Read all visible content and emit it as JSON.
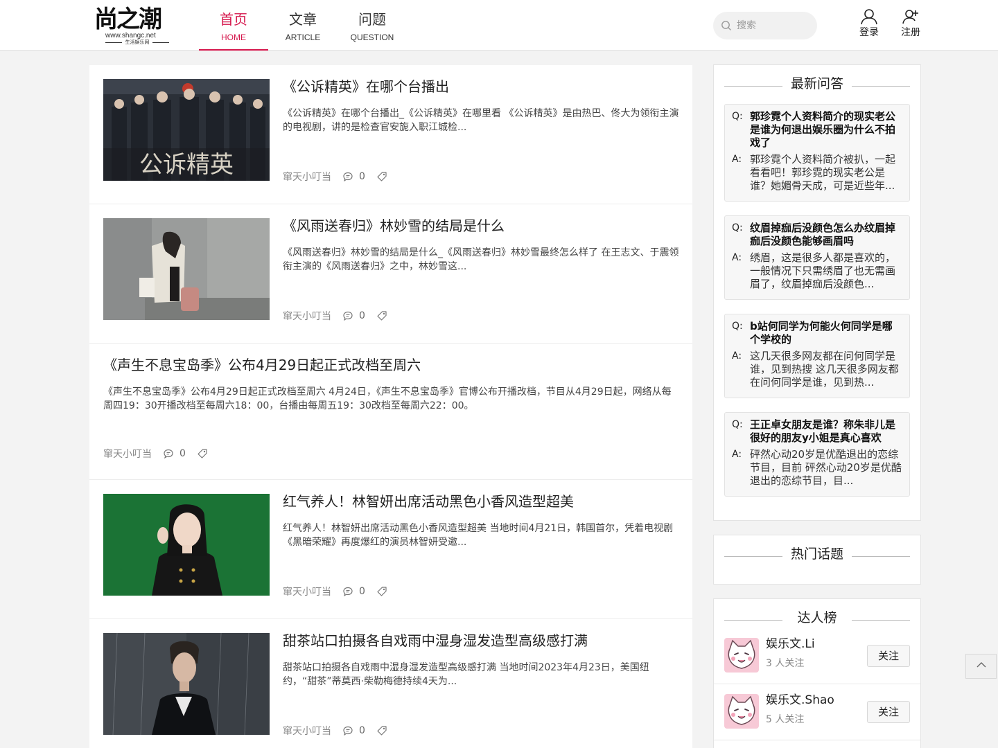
{
  "header": {
    "logo": {
      "main": "尚之潮",
      "url_text": "www.shangc.net",
      "tagline": "生活娱乐网"
    },
    "nav": [
      {
        "zh": "首页",
        "en": "HOME",
        "active": true
      },
      {
        "zh": "文章",
        "en": "ARTICLE",
        "active": false
      },
      {
        "zh": "问题",
        "en": "QUESTION",
        "active": false
      }
    ],
    "search": {
      "placeholder": "搜索",
      "value": ""
    },
    "login_label": "登录",
    "register_label": "注册",
    "accent_color": "#d5154b"
  },
  "posts": [
    {
      "title": "《公诉精英》在哪个台播出",
      "excerpt": "《公诉精英》在哪个台播出_《公诉精英》在哪里看 《公诉精英》是由热巴、佟大为领衔主演的电视剧，讲的是检查官安旎入职江城检...",
      "author": "窜天小叮当",
      "comments": "0",
      "thumb_text": "公诉精英"
    },
    {
      "title": "《风雨送春归》林妙雪的结局是什么",
      "excerpt": "《风雨送春归》林妙雪的结局是什么_《风雨送春归》林妙雪最终怎么样了 在王志文、于震领衔主演的《风雨送春归》之中，林妙雪这...",
      "author": "窜天小叮当",
      "comments": "0"
    },
    {
      "title": "《声生不息宝岛季》公布4月29日起正式改档至周六",
      "excerpt": "《声生不息宝岛季》公布4月29日起正式改档至周六 4月24日，《声生不息宝岛季》官博公布开播改档，节目从4月29日起，网络从每周四19：30开播改档至每周六18：00，台播由每周五19：30改档至每周六22：00。",
      "author": "窜天小叮当",
      "comments": "0"
    },
    {
      "title": "红气养人！林智妍出席活动黑色小香风造型超美",
      "excerpt": "红气养人！林智妍出席活动黑色小香风造型超美 当地时间4月21日，韩国首尔，凭着电视剧《黑暗荣耀》再度爆红的演员林智妍受邀...",
      "author": "窜天小叮当",
      "comments": "0"
    },
    {
      "title": "甜茶站口拍摄各自戏雨中湿身湿发造型高级感打满",
      "excerpt": "甜茶站口拍摄各自戏雨中湿身湿发造型高级感打满 当地时间2023年4月23日，美国纽约，“甜茶”蒂莫西·柴勒梅德持续4天为...",
      "author": "窜天小叮当",
      "comments": "0"
    }
  ],
  "sidebar": {
    "latest_qa": {
      "title": "最新问答",
      "q_tag": "Q:",
      "a_tag": "A:",
      "items": [
        {
          "q": "郭珍霓个人资料简介的现实老公是谁为何退出娱乐圈为什么不拍戏了",
          "a": "郭珍霓个人资料简介被扒，一起看看吧！郭珍霓的现实老公是谁？她媚骨天成，可是近些年..."
        },
        {
          "q": "纹眉掉痂后没颜色怎么办纹眉掉痂后没颜色能够画眉吗",
          "a": "绣眉，这是很多人都是喜欢的，一般情况下只需绣眉了也无需画眉了，纹眉掉痂后没颜色..."
        },
        {
          "q": "b站何同学为何能火何同学是哪个学校的",
          "a": "这几天很多网友都在问何同学是谁，见到热搜 这几天很多网友都在问何同学是谁，见到热..."
        },
        {
          "q": "王正卓女朋友是谁？称朱非儿是很好的朋友y小姐是真心喜欢",
          "a": "砰然心动20岁是优酷退出的恋综节目，目前 砰然心动20岁是优酷退出的恋综节目，目..."
        }
      ]
    },
    "hot_topics": {
      "title": "热门话题"
    },
    "ranking": {
      "title": "达人榜",
      "follow_label": "关注",
      "users": [
        {
          "name": "娱乐文.Li",
          "followers": "3 人关注"
        },
        {
          "name": "娱乐文.Shao",
          "followers": "5 人关注"
        }
      ]
    }
  }
}
